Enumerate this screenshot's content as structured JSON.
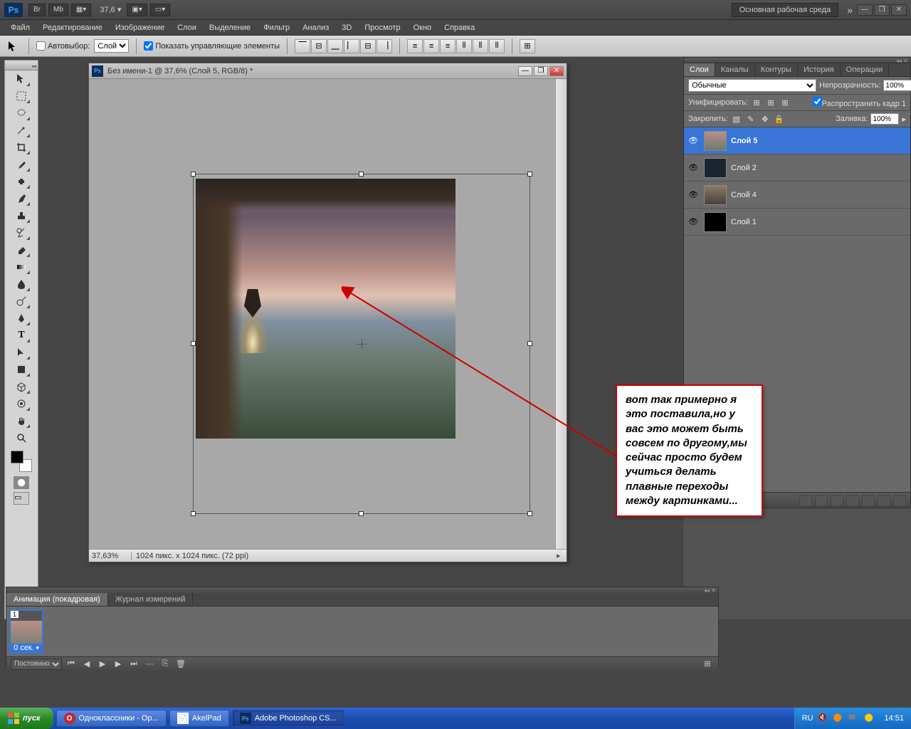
{
  "topbar": {
    "zoom": "37,6",
    "workspace": "Основная рабочая среда",
    "btn_br": "Br",
    "btn_mb": "Mb"
  },
  "menu": [
    "Файл",
    "Редактирование",
    "Изображение",
    "Слои",
    "Выделение",
    "Фильтр",
    "Анализ",
    "3D",
    "Просмотр",
    "Окно",
    "Справка"
  ],
  "options": {
    "autoselect": "Автовыбор:",
    "autoselect_value": "Слой",
    "show_controls": "Показать управляющие элементы"
  },
  "doc": {
    "title": "Без имени-1 @ 37,6% (Слой 5, RGB/8) *",
    "status_zoom": "37,63%",
    "status_info": "1024 пикс. x 1024 пикс. (72 ppi)"
  },
  "callout_text": "вот так примерно я это поставила,но у вас это может быть совсем по другому,мы сейчас просто будем учиться делать плавные переходы между картинками...",
  "layers_panel": {
    "tabs": [
      "Слои",
      "Каналы",
      "Контуры",
      "История",
      "Операции"
    ],
    "blend_value": "Обычные",
    "opacity_label": "Непрозрачность:",
    "opacity_value": "100%",
    "unify_label": "Унифицировать:",
    "propagate": "Распространить кадр 1",
    "lock_label": "Закрепить:",
    "fill_label": "Заливка:",
    "fill_value": "100%",
    "layers": [
      {
        "name": "Слой 5",
        "selected": true
      },
      {
        "name": "Слой 2",
        "selected": false
      },
      {
        "name": "Слой 4",
        "selected": false
      },
      {
        "name": "Слой 1",
        "selected": false
      }
    ]
  },
  "anim_panel": {
    "tabs": [
      "Анимация (покадровая)",
      "Журнал измерений"
    ],
    "frame_num": "1",
    "frame_dur": "0 сек.",
    "loop": "Постоянно"
  },
  "taskbar": {
    "start": "пуск",
    "items": [
      "Одноклассники - Op...",
      "AkelPad",
      "Adobe Photoshop CS..."
    ],
    "lang": "RU",
    "clock": "14:51"
  }
}
